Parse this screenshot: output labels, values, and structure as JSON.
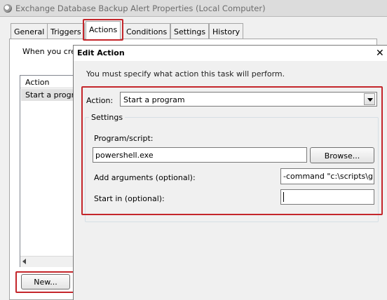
{
  "window": {
    "title": "Exchange Database Backup Alert Properties (Local Computer)",
    "icon": "clock-icon"
  },
  "tabs": [
    {
      "label": "General",
      "active": false
    },
    {
      "label": "Triggers",
      "active": false
    },
    {
      "label": "Actions",
      "active": true
    },
    {
      "label": "Conditions",
      "active": false
    },
    {
      "label": "Settings",
      "active": false
    },
    {
      "label": "History",
      "active": false
    }
  ],
  "actions_tab": {
    "description_visible": "When you cre",
    "list_header": "Action",
    "list_rows": [
      "Start a progra"
    ],
    "new_button": "New..."
  },
  "dialog": {
    "title": "Edit Action",
    "close_glyph": "✕",
    "description": "You must specify what action this task will perform.",
    "action_label": "Action:",
    "action_value": "Start a program",
    "settings_legend": "Settings",
    "program_label": "Program/script:",
    "program_value": "powershell.exe",
    "browse_button": "Browse...",
    "args_label": "Add arguments (optional):",
    "args_value": "-command \"c:\\scripts\\g",
    "startin_label": "Start in (optional):",
    "startin_value": ""
  },
  "colors": {
    "highlight_box": "#c4262b",
    "title_text": "#6d6d6d"
  }
}
